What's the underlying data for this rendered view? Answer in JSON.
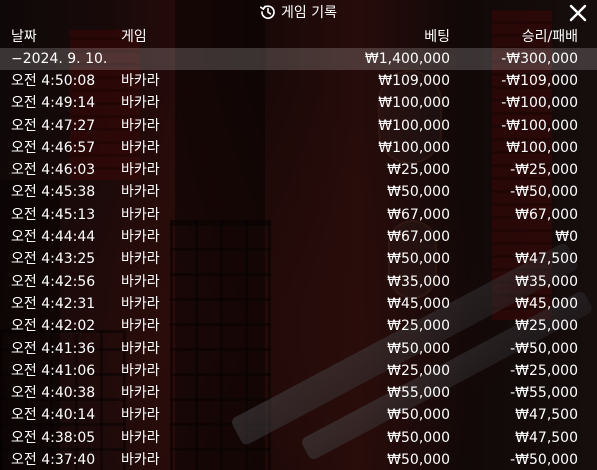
{
  "header": {
    "title": "게임 기록",
    "icon": "history-icon",
    "close_icon": "close-icon"
  },
  "columns": {
    "date": "날짜",
    "game": "게임",
    "bet": "베팅",
    "result": "승리/패배"
  },
  "summary": {
    "date": "−2024. 9. 10.",
    "bet": "₩1,400,000",
    "result": "-₩300,000"
  },
  "rows": [
    {
      "time": "오전 4:50:08",
      "game": "바카라",
      "bet": "₩109,000",
      "result": "-₩109,000"
    },
    {
      "time": "오전 4:49:14",
      "game": "바카라",
      "bet": "₩100,000",
      "result": "-₩100,000"
    },
    {
      "time": "오전 4:47:27",
      "game": "바카라",
      "bet": "₩100,000",
      "result": "-₩100,000"
    },
    {
      "time": "오전 4:46:57",
      "game": "바카라",
      "bet": "₩100,000",
      "result": "₩100,000"
    },
    {
      "time": "오전 4:46:03",
      "game": "바카라",
      "bet": "₩25,000",
      "result": "-₩25,000"
    },
    {
      "time": "오전 4:45:38",
      "game": "바카라",
      "bet": "₩50,000",
      "result": "-₩50,000"
    },
    {
      "time": "오전 4:45:13",
      "game": "바카라",
      "bet": "₩67,000",
      "result": "₩67,000"
    },
    {
      "time": "오전 4:44:44",
      "game": "바카라",
      "bet": "₩67,000",
      "result": "₩0"
    },
    {
      "time": "오전 4:43:25",
      "game": "바카라",
      "bet": "₩50,000",
      "result": "₩47,500"
    },
    {
      "time": "오전 4:42:56",
      "game": "바카라",
      "bet": "₩35,000",
      "result": "₩35,000"
    },
    {
      "time": "오전 4:42:31",
      "game": "바카라",
      "bet": "₩45,000",
      "result": "₩45,000"
    },
    {
      "time": "오전 4:42:02",
      "game": "바카라",
      "bet": "₩25,000",
      "result": "₩25,000"
    },
    {
      "time": "오전 4:41:36",
      "game": "바카라",
      "bet": "₩50,000",
      "result": "-₩50,000"
    },
    {
      "time": "오전 4:41:06",
      "game": "바카라",
      "bet": "₩25,000",
      "result": "-₩25,000"
    },
    {
      "time": "오전 4:40:38",
      "game": "바카라",
      "bet": "₩55,000",
      "result": "-₩55,000"
    },
    {
      "time": "오전 4:40:14",
      "game": "바카라",
      "bet": "₩50,000",
      "result": "₩47,500"
    },
    {
      "time": "오전 4:38:05",
      "game": "바카라",
      "bet": "₩50,000",
      "result": "₩47,500"
    },
    {
      "time": "오전 4:37:40",
      "game": "바카라",
      "bet": "₩50,000",
      "result": "-₩50,000"
    }
  ],
  "colors": {
    "text": "#ffffff",
    "overlay": "#000000",
    "summary_bg": "#ffffff"
  }
}
